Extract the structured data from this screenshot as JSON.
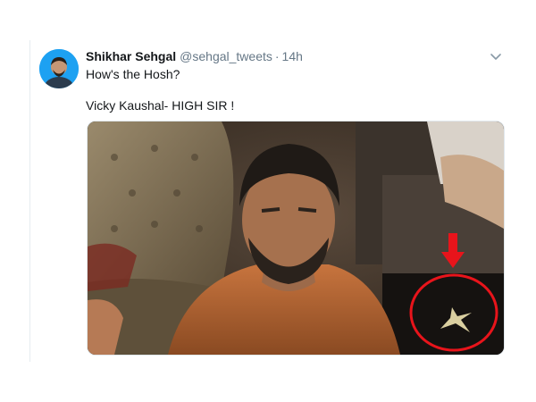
{
  "tweet": {
    "author_name": "Shikhar Sehgal",
    "handle": "@sehgal_tweets",
    "separator": "·",
    "time": "14h",
    "text_line_1": "How's the Hosh?",
    "text_line_2": "Vicky Kaushal- HIGH SIR !"
  },
  "icons": {
    "menu": "chevron-down-icon",
    "annotation_arrow": "arrow-down-icon",
    "annotation_circle": "highlight-circle-icon"
  },
  "colors": {
    "name": "#14171a",
    "secondary_text": "#657786",
    "avatar_bg": "#1da1f2",
    "annotation": "#e8141b"
  }
}
